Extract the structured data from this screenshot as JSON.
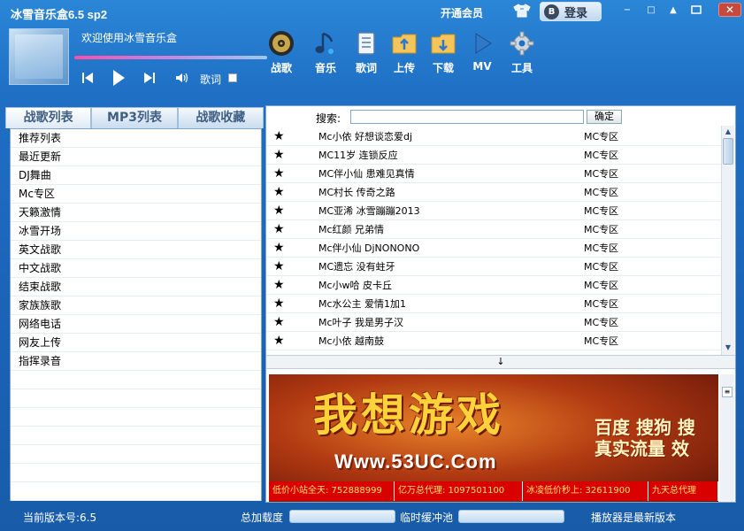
{
  "window": {
    "title": "冰雪音乐盒6.5 sp2",
    "vip_label": "开通会员",
    "login_label": "登录",
    "login_badge": "B",
    "minimize": "−",
    "restore": "□",
    "up": "▲",
    "close": "✕"
  },
  "player": {
    "welcome": "欢迎使用冰雪音乐盒",
    "progress": 0.0,
    "lyric_label": "歌词",
    "lyric_checked": false
  },
  "toolbar": {
    "items": [
      {
        "label": "战歌",
        "icon": "record-disc-icon"
      },
      {
        "label": "音乐",
        "icon": "music-note-icon"
      },
      {
        "label": "歌词",
        "icon": "lyrics-page-icon"
      },
      {
        "label": "上传",
        "icon": "upload-folder-icon"
      },
      {
        "label": "下载",
        "icon": "download-folder-icon"
      },
      {
        "label": "MV",
        "icon": "play-video-icon"
      },
      {
        "label": "工具",
        "icon": "gear-icon"
      }
    ]
  },
  "left_tabs": [
    "战歌列表",
    "MP3列表",
    "战歌收藏"
  ],
  "categories": [
    "推荐列表",
    "最近更新",
    "DJ舞曲",
    "Mc专区",
    "天籁激情",
    "冰雪开场",
    "英文战歌",
    "中文战歌",
    "结束战歌",
    "家族族歌",
    "网络电话",
    "网友上传",
    "指挥录音"
  ],
  "search": {
    "label": "搜索:",
    "value": "",
    "placeholder": "",
    "button": "确定"
  },
  "songs": [
    {
      "title": "Mc小依 好想谈恋爱dj",
      "category": "MC专区"
    },
    {
      "title": "MC11岁 连锁反应",
      "category": "MC专区"
    },
    {
      "title": "MC伴小仙 患难见真情",
      "category": "MC专区"
    },
    {
      "title": "MC村长 传奇之路",
      "category": "MC专区"
    },
    {
      "title": "MC亚浠 冰雪蹦蹦2013",
      "category": "MC专区"
    },
    {
      "title": "Mc红颜 兄弟情",
      "category": "MC专区"
    },
    {
      "title": "Mc伴小仙 DjNONONO",
      "category": "MC专区"
    },
    {
      "title": "MC遗忘 没有蛀牙",
      "category": "MC专区"
    },
    {
      "title": "Mc小w哈 皮卡丘",
      "category": "MC专区"
    },
    {
      "title": "Mc水公主 爱情1加1",
      "category": "MC专区"
    },
    {
      "title": "Mc叶子 我是男子汉",
      "category": "MC专区"
    },
    {
      "title": "Mc小依 越南鼓",
      "category": "MC专区"
    }
  ],
  "star_glyph": "★",
  "splitter_arrow": "↓",
  "ad": {
    "title": "我想游戏",
    "url": "Www.53UC.Com",
    "right_line1": "百度 搜狗 搜",
    "right_line2": "真实流量 效",
    "strip": [
      "低价小站全天: 752888999",
      "亿万总代理: 1097501100",
      "冰凌低价秒上: 32611900",
      "九天总代理"
    ]
  },
  "status": {
    "version": "当前版本号:6.5",
    "total_load": "总加载度",
    "temp_buffer": "临时缓冲池",
    "player_state": "播放器是最新版本"
  },
  "colors": {
    "accent": "#1f6fc4",
    "tab_text": "#3f5f84",
    "ad_red": "#d90000"
  }
}
